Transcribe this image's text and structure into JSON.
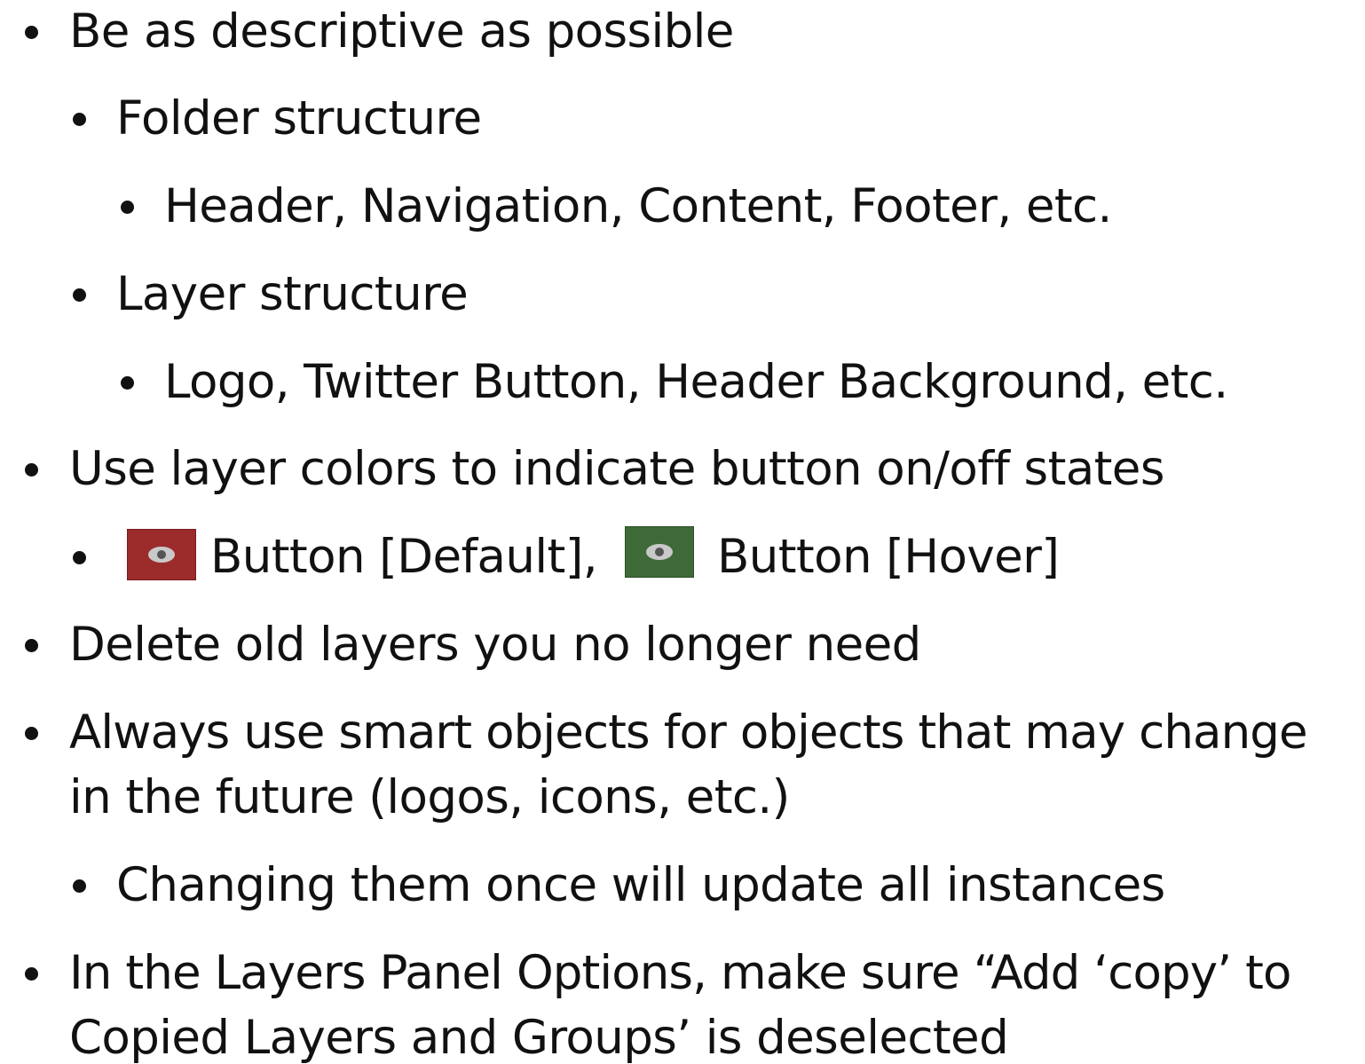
{
  "items": [
    {
      "text": "Be as descriptive as possible"
    },
    {
      "text": "Folder structure"
    },
    {
      "text": "Header, Navigation, Content, Footer, etc."
    },
    {
      "text": "Layer structure"
    },
    {
      "text": "Logo, Twitter Button, Header Background, etc."
    },
    {
      "text": "Use layer colors to indicate button on/off states"
    },
    {
      "text_a": "Button [Default],",
      "text_b": "Button [Hover]",
      "icon_a": "eye-icon",
      "icon_b": "eye-icon",
      "color_a": "#9c2b2b",
      "color_b": "#3e6a37"
    },
    {
      "text": "Delete old layers you no longer need"
    },
    {
      "line1": "Always use smart objects for objects that may change",
      "line2": "in the future (logos, icons, etc.)"
    },
    {
      "text": "Changing them once will update all instances"
    },
    {
      "line1": "In the Layers Panel Options, make sure “Add ‘copy’ to",
      "line2": "Copied Layers and Groups’ is deselected"
    }
  ]
}
